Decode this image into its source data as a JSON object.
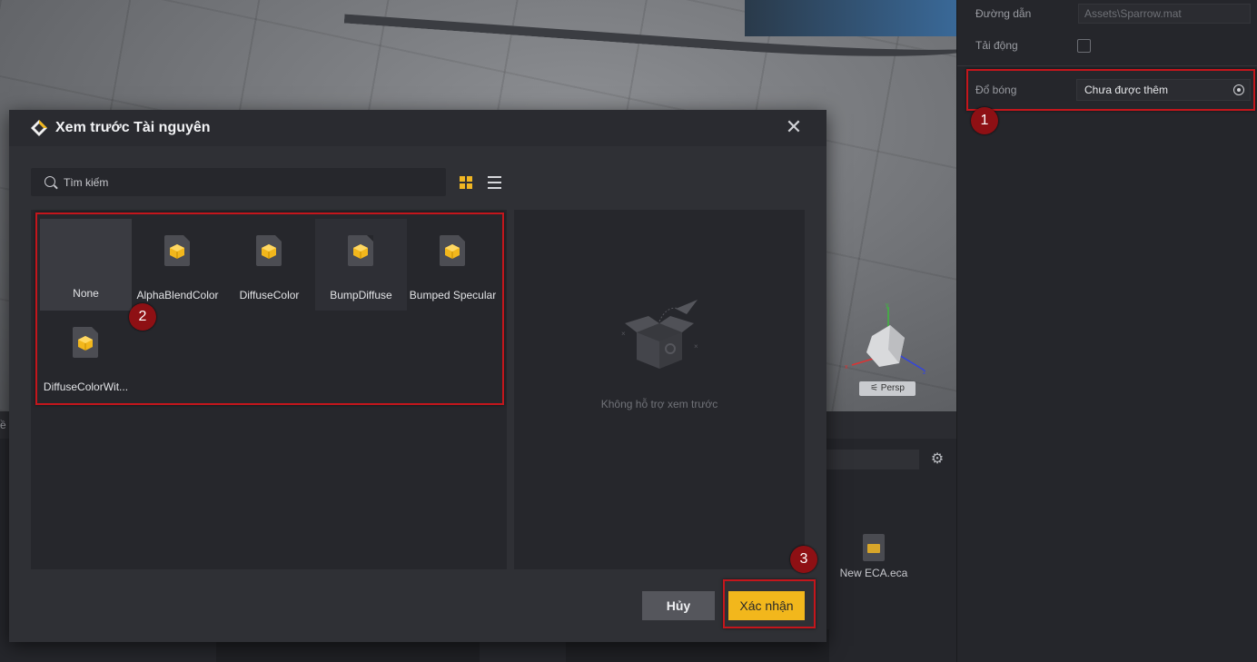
{
  "inspector": {
    "path_label": "Đường dẫn",
    "path_value": "Assets\\Sparrow.mat",
    "autoload_label": "Tải động",
    "shadow_label": "Đổ bóng",
    "shadow_value": "Chưa được thêm"
  },
  "scene": {
    "persp_label": "⚟ Persp"
  },
  "bottom_panel": {
    "file_name": "New ECA.eca",
    "left_fragment": "ề"
  },
  "dialog": {
    "title": "Xem trước Tài nguyên",
    "search_placeholder": "Tìm kiếm",
    "assets": [
      {
        "name": "None"
      },
      {
        "name": "AlphaBlendColor"
      },
      {
        "name": "DiffuseColor"
      },
      {
        "name": "BumpDiffuse"
      },
      {
        "name": "Bumped Specular"
      },
      {
        "name": "DiffuseColorWit..."
      }
    ],
    "preview_empty_text": "Không hỗ trợ xem trước",
    "cancel_label": "Hủy",
    "confirm_label": "Xác nhận"
  },
  "steps": [
    "1",
    "2",
    "3"
  ],
  "colors": {
    "accent": "#f2b71c",
    "highlight": "#c4161c",
    "badge": "#8e1014",
    "panel": "#26272c"
  }
}
